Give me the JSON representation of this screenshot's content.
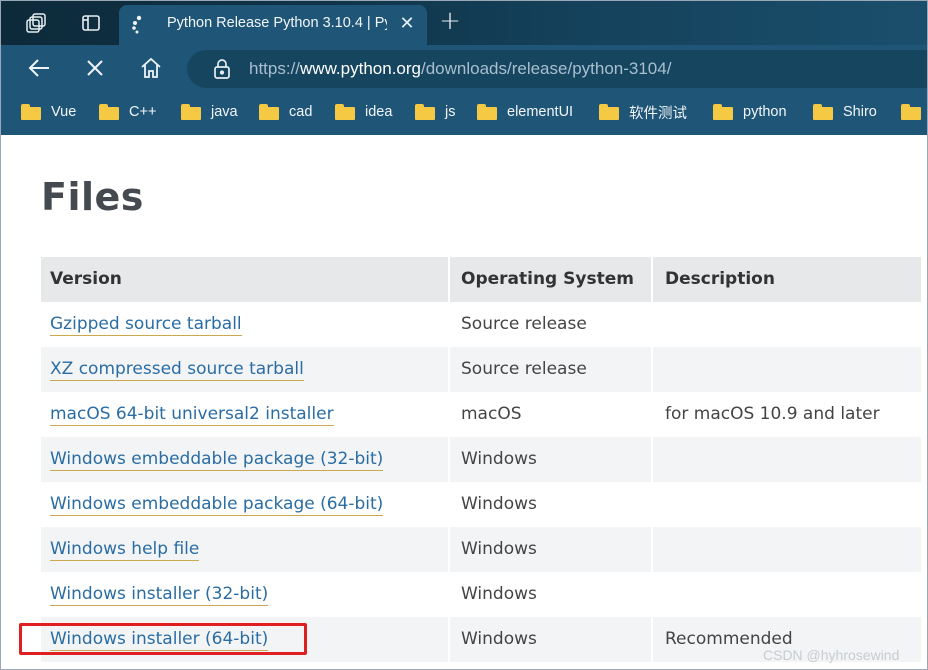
{
  "browser": {
    "tab_title": "Python Release Python 3.10.4 | Py",
    "new_tab_symbol": "+",
    "url_prefix": "https://",
    "url_host": "www.python.org",
    "url_path": "/downloads/release/python-3104/"
  },
  "bookmarks": [
    {
      "label": "Vue"
    },
    {
      "label": "C++"
    },
    {
      "label": "java"
    },
    {
      "label": "cad"
    },
    {
      "label": "idea"
    },
    {
      "label": "js"
    },
    {
      "label": "elementUI"
    },
    {
      "label": "软件测试"
    },
    {
      "label": "python"
    },
    {
      "label": "Shiro"
    }
  ],
  "page": {
    "heading": "Files",
    "columns": [
      "Version",
      "Operating System",
      "Description"
    ],
    "rows": [
      {
        "version": "Gzipped source tarball",
        "os": "Source release",
        "description": ""
      },
      {
        "version": "XZ compressed source tarball",
        "os": "Source release",
        "description": ""
      },
      {
        "version": "macOS 64-bit universal2 installer",
        "os": "macOS",
        "description": "for macOS 10.9 and later"
      },
      {
        "version": "Windows embeddable package (32-bit)",
        "os": "Windows",
        "description": ""
      },
      {
        "version": "Windows embeddable package (64-bit)",
        "os": "Windows",
        "description": ""
      },
      {
        "version": "Windows help file",
        "os": "Windows",
        "description": ""
      },
      {
        "version": "Windows installer (32-bit)",
        "os": "Windows",
        "description": ""
      },
      {
        "version": "Windows installer (64-bit)",
        "os": "Windows",
        "description": "Recommended"
      }
    ]
  },
  "watermark": "CSDN @hyhrosewind",
  "colors": {
    "link": "#2b6da3",
    "highlight": "#e02020",
    "chrome": "#1f5577"
  }
}
